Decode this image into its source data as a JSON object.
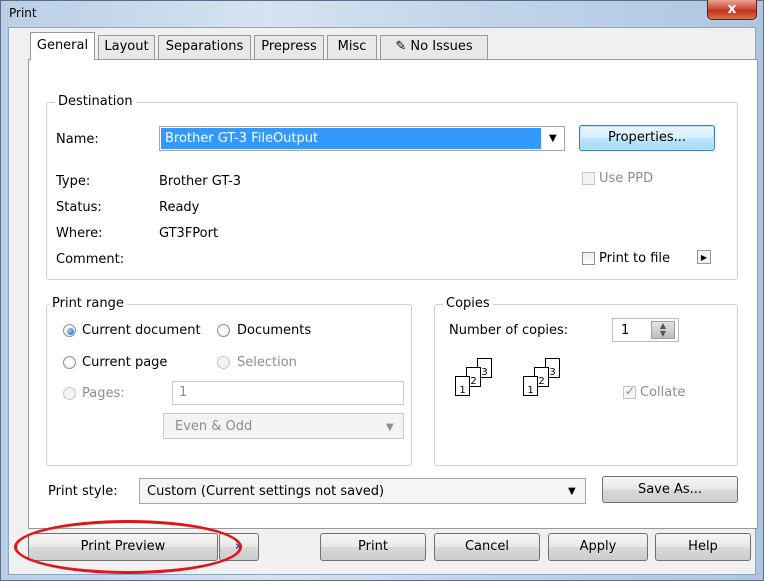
{
  "window": {
    "title": "Print",
    "close_glyph": "x"
  },
  "tabs": [
    {
      "label": "General",
      "active": true
    },
    {
      "label": "Layout"
    },
    {
      "label": "Separations"
    },
    {
      "label": "Prepress"
    },
    {
      "label": "Misc"
    },
    {
      "label": "No Issues",
      "icon": "issues-icon"
    }
  ],
  "destination": {
    "legend": "Destination",
    "name_label": "Name:",
    "name_value": "Brother GT-3 FileOutput",
    "properties_label": "Properties...",
    "type_label": "Type:",
    "type_value": "Brother GT-3",
    "status_label": "Status:",
    "status_value": "Ready",
    "where_label": "Where:",
    "where_value": "GT3FPort",
    "comment_label": "Comment:",
    "use_ppd_label": "Use PPD",
    "print_to_file_label": "Print to file"
  },
  "print_range": {
    "legend": "Print range",
    "current_document": "Current document",
    "documents": "Documents",
    "current_page": "Current page",
    "selection": "Selection",
    "pages_label": "Pages:",
    "pages_value": "1",
    "even_odd": "Even & Odd"
  },
  "copies": {
    "legend": "Copies",
    "number_label": "Number of copies:",
    "number_value": "1",
    "collate_label": "Collate",
    "stack_pages": [
      "1",
      "2",
      "3"
    ]
  },
  "print_style": {
    "label": "Print style:",
    "value": "Custom (Current settings not saved)",
    "save_as": "Save As..."
  },
  "buttons": {
    "print_preview": "Print Preview",
    "print": "Print",
    "cancel": "Cancel",
    "apply": "Apply",
    "help": "Help"
  },
  "colors": {
    "highlight": "#3399ff",
    "annotation": "#e0151b"
  }
}
